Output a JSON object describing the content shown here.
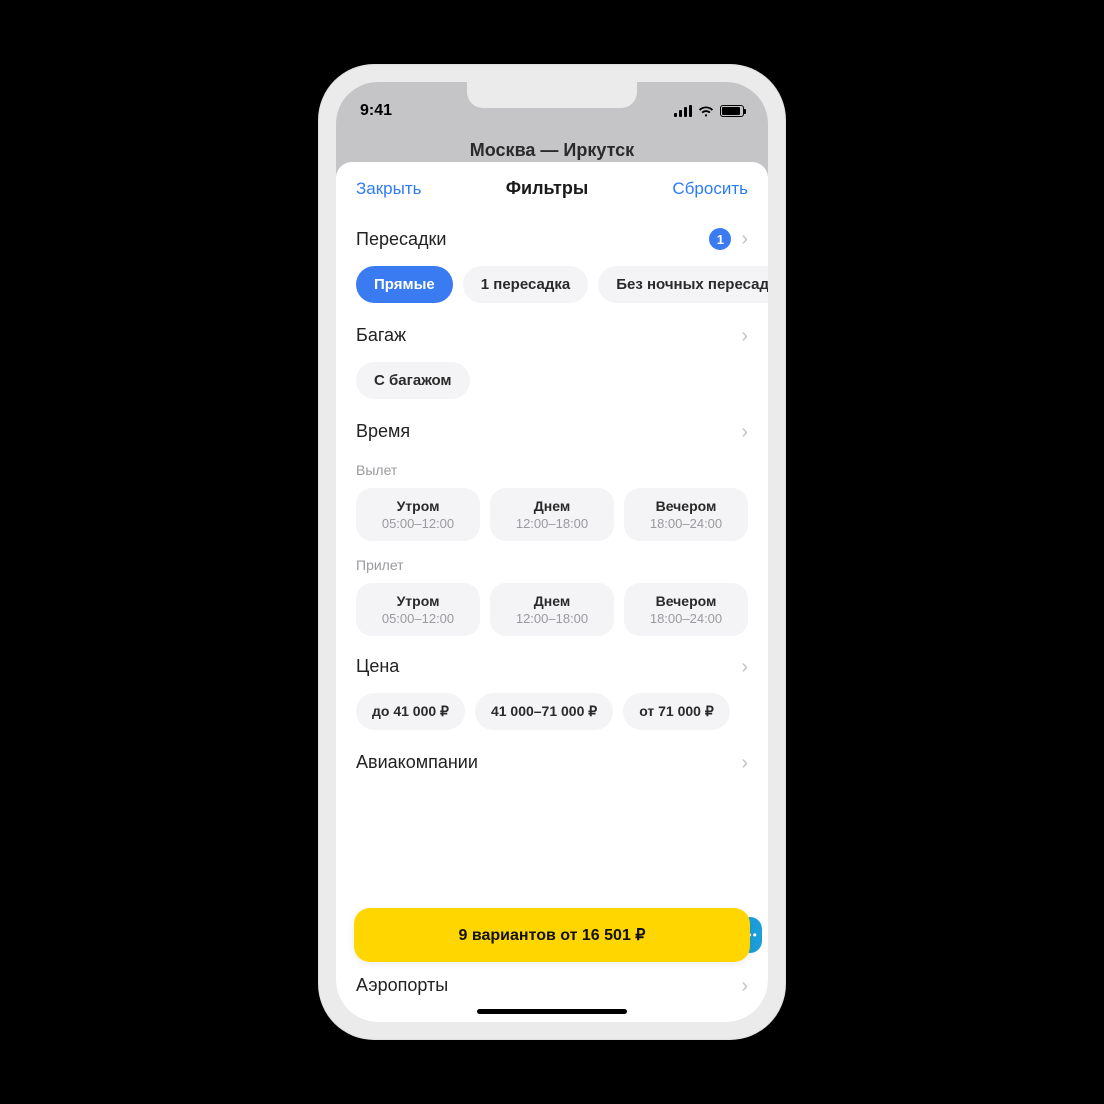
{
  "statusbar": {
    "time": "9:41"
  },
  "nav_behind": "Москва — Иркутск",
  "header": {
    "close": "Закрыть",
    "title": "Фильтры",
    "reset": "Сбросить"
  },
  "sections": {
    "transfers": {
      "title": "Пересадки",
      "badge": "1",
      "chips": [
        {
          "label": "Прямые",
          "selected": true
        },
        {
          "label": "1 пересадка",
          "selected": false
        },
        {
          "label": "Без ночных пересадок",
          "selected": false
        }
      ]
    },
    "baggage": {
      "title": "Багаж",
      "chips": [
        {
          "label": "С багажом",
          "selected": false
        }
      ]
    },
    "time": {
      "title": "Время",
      "depart_label": "Вылет",
      "arrive_label": "Прилет",
      "depart": [
        {
          "label": "Утром",
          "range": "05:00–12:00"
        },
        {
          "label": "Днем",
          "range": "12:00–18:00"
        },
        {
          "label": "Вечером",
          "range": "18:00–24:00"
        }
      ],
      "arrive": [
        {
          "label": "Утром",
          "range": "05:00–12:00"
        },
        {
          "label": "Днем",
          "range": "12:00–18:00"
        },
        {
          "label": "Вечером",
          "range": "18:00–24:00"
        }
      ]
    },
    "price": {
      "title": "Цена",
      "chips": [
        {
          "label": "до 41 000 ₽"
        },
        {
          "label": "41 000–71 000 ₽"
        },
        {
          "label": "от 71 000 ₽"
        }
      ]
    },
    "airlines": {
      "title": "Авиакомпании"
    },
    "airports": {
      "title": "Аэропорты"
    }
  },
  "cta": "9 вариантов от 16 501 ₽"
}
